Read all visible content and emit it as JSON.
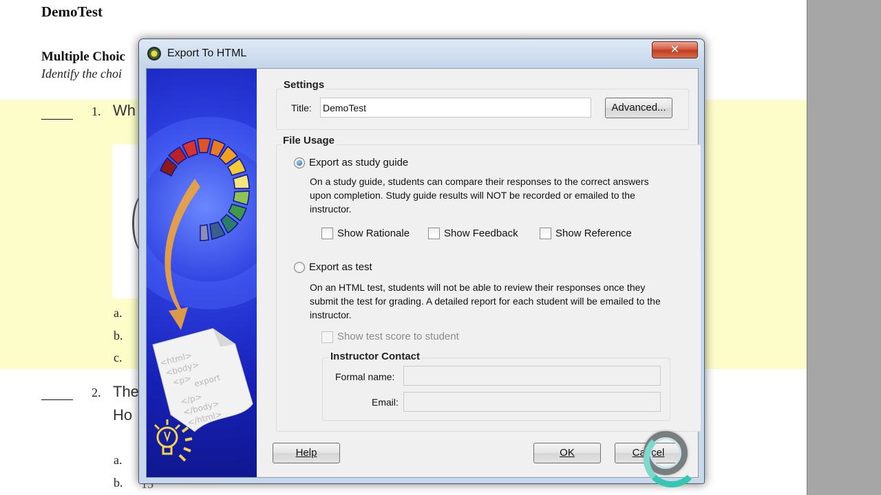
{
  "document": {
    "title": "DemoTest",
    "section_title": "Multiple Choic",
    "section_instruction": "Identify the choi",
    "questions": [
      {
        "number": "1.",
        "text": "Wh",
        "options": [
          "a.",
          "b.",
          "c."
        ]
      },
      {
        "number": "2.",
        "text_line1": "The",
        "text_line2": "Ho",
        "options": [
          "a.",
          "b."
        ],
        "option_b_partial": "15"
      }
    ]
  },
  "dialog": {
    "title": "Export To HTML",
    "close_label": "✕",
    "settings": {
      "group_label": "Settings",
      "title_label": "Title:",
      "title_value": "DemoTest",
      "advanced_button": "Advanced..."
    },
    "file_usage": {
      "group_label": "File Usage",
      "study_guide": {
        "label": "Export as study guide",
        "selected": true,
        "description": "On a study guide, students can compare their responses to the correct answers upon completion.  Study guide results will NOT be recorded or emailed to the instructor.",
        "checkboxes": [
          {
            "label": "Show Rationale",
            "checked": false
          },
          {
            "label": "Show Feedback",
            "checked": false
          },
          {
            "label": "Show Reference",
            "checked": false
          }
        ]
      },
      "test": {
        "label": "Export as test",
        "selected": false,
        "description": "On an HTML test, students will not be able to review their responses once they submit the test for grading.  A detailed report for each student will be emailed to the instructor.",
        "show_score_label": "Show test score to student",
        "show_score_checked": false
      },
      "instructor_contact": {
        "group_label": "Instructor Contact",
        "formal_name_label": "Formal name:",
        "formal_name_value": "",
        "email_label": "Email:",
        "email_value": ""
      }
    },
    "buttons": {
      "help": "Help",
      "ok": "OK",
      "cancel": "Cancel"
    },
    "side_panel": {
      "paper_lines": [
        "<html>",
        "<body>",
        "<p>",
        "export",
        "</p>",
        "</body>",
        "</html>"
      ]
    }
  },
  "colors": {
    "highlight_band": "#fdfdc9",
    "side_panel_blue": "#1e2fd0",
    "close_button_red": "#c8432a",
    "gray_margin": "#a6a6a6"
  }
}
